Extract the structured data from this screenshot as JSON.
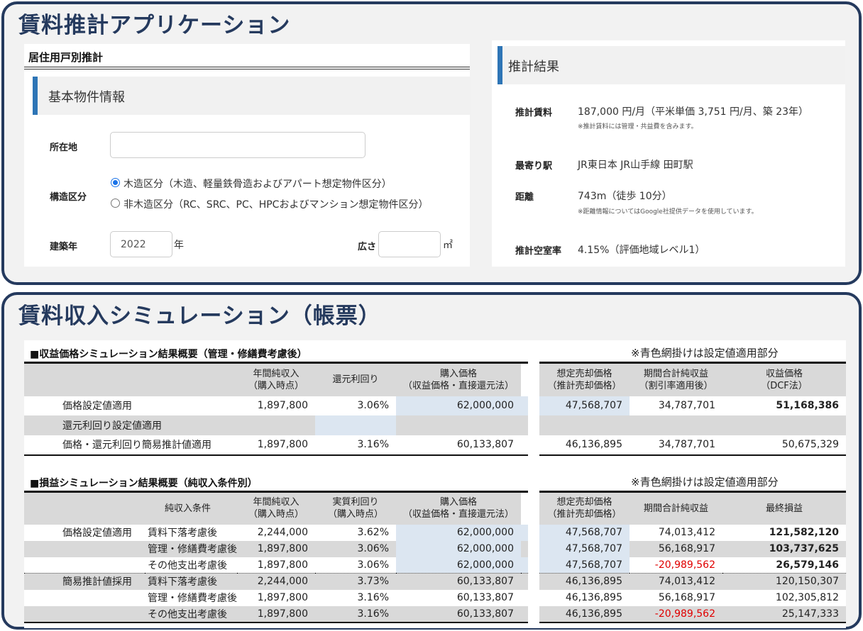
{
  "app": {
    "title": "賃料推計アプリケーション"
  },
  "left": {
    "heading": "居住用戸別推計",
    "section": "基本物件情報",
    "location_label": "所在地",
    "location_value": "",
    "structure_label": "構造区分",
    "structure_options": [
      "木造区分（木造、軽量鉄骨造およびアパート想定物件区分）",
      "非木造区分（RC、SRC、PC、HPCおよびマンション想定物件区分）"
    ],
    "structure_selected": 0,
    "year_label": "建築年",
    "year_value": "2022",
    "year_unit": "年",
    "area_label": "広さ",
    "area_value": "",
    "area_unit": "㎡"
  },
  "result": {
    "section": "推計結果",
    "rent_label": "推計賃料",
    "rent_value": "187,000 円/月（平米単価 3,751 円/月、築 23年）",
    "rent_note": "※推計賃料には管理・共益費を含みます。",
    "station_label": "最寄り駅",
    "station_value": "JR東日本 JR山手線 田町駅",
    "distance_label": "距離",
    "distance_value": "743m（徒歩 10分）",
    "distance_note": "※距離情報についてはGoogle社提供データを使用しています。",
    "vacancy_label": "推計空室率",
    "vacancy_value": "4.15%（評価地域レベル1）"
  },
  "sim": {
    "title": "賃料収入シミュレーション（帳票）",
    "t1": {
      "title": "■収益価格シミュレーション結果概要（管理・修繕費考慮後）",
      "note": "※青色網掛けは設定値適用部分",
      "headers": [
        "年間純収入\n（購入時点）",
        "還元利回り",
        "購入価格\n（収益価格・直接還元法）"
      ],
      "headers_r": [
        "想定売却価格\n（推計売却価格）",
        "期間合計純収益\n（割引率適用後）",
        "収益価格\n（DCF法）"
      ],
      "rows": [
        {
          "label": "価格設定値適用",
          "vals": [
            "1,897,800",
            "3.06%",
            "62,000,000"
          ],
          "rvals": [
            "47,568,707",
            "34,787,701",
            "51,168,386"
          ]
        },
        {
          "label": "還元利回り設定値適用",
          "vals": [
            "",
            "",
            ""
          ],
          "rvals": [
            "",
            "",
            ""
          ]
        },
        {
          "label": "価格・還元利回り簡易推計値適用",
          "vals": [
            "1,897,800",
            "3.16%",
            "60,133,807"
          ],
          "rvals": [
            "46,136,895",
            "34,787,701",
            "50,675,329"
          ]
        }
      ]
    },
    "t2": {
      "title": "■損益シミュレーション結果概要（純収入条件別）",
      "note": "※青色網掛けは設定値適用部分",
      "headers": [
        "純収入条件",
        "年間純収入\n（購入時点）",
        "実質利回り\n（購入時点）",
        "購入価格\n（収益価格・直接還元法）"
      ],
      "headers_r": [
        "想定売却価格\n（推計売却価格）",
        "期間合計純収益",
        "最終損益"
      ],
      "rows": [
        {
          "group": "価格設定値適用",
          "cond": "賃料下落考慮後",
          "vals": [
            "2,244,000",
            "3.62%",
            "62,000,000"
          ],
          "rvals": [
            "47,568,707",
            "74,013,412",
            "121,582,120"
          ]
        },
        {
          "group": "",
          "cond": "管理・修繕費考慮後",
          "vals": [
            "1,897,800",
            "3.06%",
            "62,000,000"
          ],
          "rvals": [
            "47,568,707",
            "56,168,917",
            "103,737,625"
          ]
        },
        {
          "group": "",
          "cond": "その他支出考慮後",
          "vals": [
            "1,897,800",
            "3.06%",
            "62,000,000"
          ],
          "rvals": [
            "47,568,707",
            "-20,989,562",
            "26,579,146"
          ]
        },
        {
          "group": "簡易推計値採用",
          "cond": "賃料下落考慮後",
          "vals": [
            "2,244,000",
            "3.73%",
            "60,133,807"
          ],
          "rvals": [
            "46,136,895",
            "74,013,412",
            "120,150,307"
          ]
        },
        {
          "group": "",
          "cond": "管理・修繕費考慮後",
          "vals": [
            "1,897,800",
            "3.16%",
            "60,133,807"
          ],
          "rvals": [
            "46,136,895",
            "56,168,917",
            "102,305,812"
          ]
        },
        {
          "group": "",
          "cond": "その他支出考慮後",
          "vals": [
            "1,897,800",
            "3.16%",
            "60,133,807"
          ],
          "rvals": [
            "46,136,895",
            "-20,989,562",
            "25,147,333"
          ]
        }
      ]
    }
  },
  "colors": {
    "navy": "#253a5e",
    "accent": "#2e75b6",
    "highlight": "#dce6f1",
    "negative": "#e00000"
  }
}
